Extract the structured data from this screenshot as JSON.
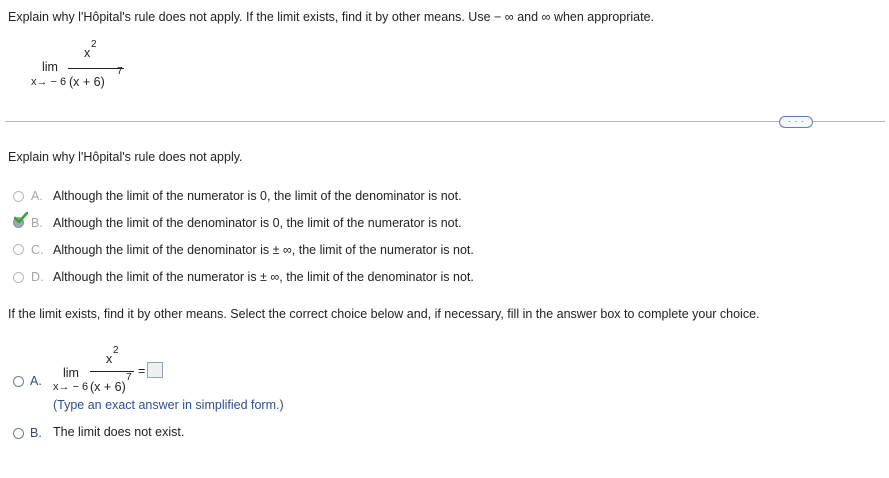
{
  "prompt": {
    "text": "Explain why l'Hôpital's rule does not apply. If the limit exists, find it by other means. Use",
    "minus_inf": "− ∞",
    "and": "and",
    "inf": "∞",
    "tail": "when appropriate."
  },
  "expression": {
    "lim": "lim",
    "numerator_base": "x",
    "numerator_exp": "2",
    "under": "x→ − 6",
    "denominator_base": "(x + 6)",
    "denominator_exp": "7"
  },
  "more_button": "· · ·",
  "section1": {
    "heading": "Explain why l'Hôpital's rule does not apply.",
    "options": [
      {
        "letter": "A.",
        "text": "Although the limit of the numerator is 0, the limit of the denominator is not."
      },
      {
        "letter": "B.",
        "text": "Although the limit of the denominator is 0, the limit of the numerator is not."
      },
      {
        "letter": "C.",
        "text": "Although the limit of the denominator is  ± ∞, the limit of the numerator is not."
      },
      {
        "letter": "D.",
        "text": "Although the limit of the numerator is  ± ∞, the limit of the denominator is not."
      }
    ],
    "selected_option": "B",
    "selected_is_correct": true
  },
  "section2": {
    "heading": "If the limit exists, find it by other means. Select the correct choice below and, if necessary, fill in the answer box to complete your choice.",
    "option_a": {
      "letter": "A.",
      "equals": "=",
      "answer_value": "",
      "hint": "(Type an exact answer in simplified form.)"
    },
    "option_b": {
      "letter": "B.",
      "text": "The limit does not exist."
    }
  },
  "colors": {
    "check": "#3aa335",
    "hint": "#2b4f8f",
    "option_letter_light": "#a6a6a6",
    "option_letter_dark": "#3a4a66"
  }
}
